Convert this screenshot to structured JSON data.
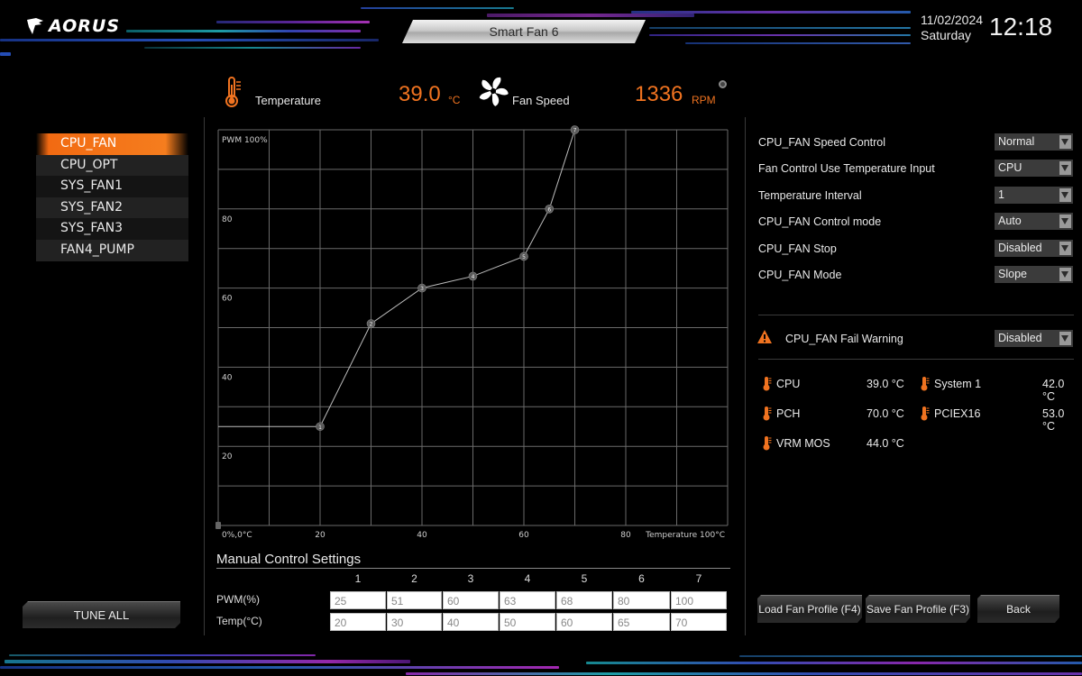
{
  "brand": {
    "logo_text": "AORUS"
  },
  "header": {
    "title": "Smart Fan 6",
    "date": "11/02/2024",
    "day": "Saturday",
    "time": "12:18"
  },
  "status": {
    "temperature_label": "Temperature",
    "temperature_value": "39.0",
    "temperature_unit": "°C",
    "fan_speed_label": "Fan Speed",
    "fan_speed_value": "1336",
    "fan_speed_unit": "RPM",
    "accent_color": "#f07320"
  },
  "fan_list": {
    "selected": "CPU_FAN",
    "items": [
      "CPU_FAN",
      "CPU_OPT",
      "SYS_FAN1",
      "SYS_FAN2",
      "SYS_FAN3",
      "FAN4_PUMP"
    ]
  },
  "tune_all_label": "TUNE ALL",
  "chart_data": {
    "type": "line",
    "title": "",
    "xlabel": "Temperature 100°C",
    "ylabel": "PWM 100%",
    "origin_label": "0%,0°C",
    "x_ticks": [
      "20",
      "40",
      "60",
      "80"
    ],
    "y_ticks": [
      "80",
      "60",
      "40",
      "20"
    ],
    "xlim": [
      0,
      100
    ],
    "ylim": [
      0,
      100
    ],
    "grid": true,
    "grid_step_x": 10,
    "grid_step_y": 10,
    "leading_flat_from_x": 0,
    "points": [
      {
        "label": "1",
        "temp": 20,
        "pwm": 25
      },
      {
        "label": "2",
        "temp": 30,
        "pwm": 51
      },
      {
        "label": "3",
        "temp": 40,
        "pwm": 60
      },
      {
        "label": "4",
        "temp": 50,
        "pwm": 63
      },
      {
        "label": "5",
        "temp": 60,
        "pwm": 68
      },
      {
        "label": "6",
        "temp": 65,
        "pwm": 80
      },
      {
        "label": "7",
        "temp": 70,
        "pwm": 100
      }
    ],
    "origin_point_label": "0"
  },
  "manual": {
    "title": "Manual Control Settings",
    "columns": [
      "1",
      "2",
      "3",
      "4",
      "5",
      "6",
      "7"
    ],
    "pwm_label": "PWM(%)",
    "temp_label": "Temp(°C)",
    "pwm_values": [
      "25",
      "51",
      "60",
      "63",
      "68",
      "80",
      "100"
    ],
    "temp_values": [
      "20",
      "30",
      "40",
      "50",
      "60",
      "65",
      "70"
    ]
  },
  "settings": [
    {
      "label": "CPU_FAN Speed Control",
      "value": "Normal"
    },
    {
      "label": "Fan Control Use Temperature Input",
      "value": "CPU"
    },
    {
      "label": "Temperature Interval",
      "value": "1"
    },
    {
      "label": "CPU_FAN Control mode",
      "value": "Auto"
    },
    {
      "label": "CPU_FAN Stop",
      "value": "Disabled"
    },
    {
      "label": "CPU_FAN Mode",
      "value": "Slope"
    }
  ],
  "fail_warning": {
    "label": "CPU_FAN Fail Warning",
    "value": "Disabled"
  },
  "sensors": [
    {
      "name": "CPU",
      "value": "39.0 °C"
    },
    {
      "name": "System 1",
      "value": "42.0 °C"
    },
    {
      "name": "PCH",
      "value": "70.0 °C"
    },
    {
      "name": "PCIEX16",
      "value": "53.0 °C"
    },
    {
      "name": "VRM MOS",
      "value": "44.0 °C"
    }
  ],
  "buttons": {
    "load_profile": "Load Fan Profile (F4)",
    "save_profile": "Save Fan Profile (F3)",
    "back": "Back"
  }
}
